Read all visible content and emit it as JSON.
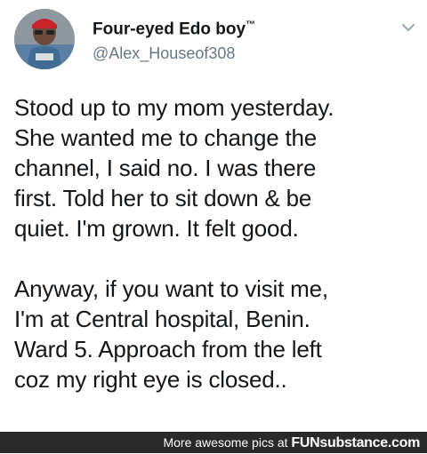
{
  "tweet": {
    "display_name": "Four-eyed Edo boy",
    "trademark": "™",
    "handle": "@Alex_Houseof308",
    "paragraph_1": "Stood up to my mom yesterday.\nShe wanted me to change the\nchannel, I said no. I was there\nfirst. Told her to sit down & be\nquiet. I'm grown. It felt good.",
    "paragraph_2": "Anyway, if you want to visit me,\nI'm at Central hospital, Benin.\nWard 5. Approach from the left\ncoz my right eye is closed.."
  },
  "watermark": {
    "prefix": "More awesome pics at ",
    "brand": "FUNsubstance.com"
  },
  "icons": {
    "menu": "chevron-down-icon",
    "avatar": "avatar-photo"
  },
  "colors": {
    "text": "#14171a",
    "secondary": "#657786",
    "watermark_bg": "#2a2a2a"
  }
}
